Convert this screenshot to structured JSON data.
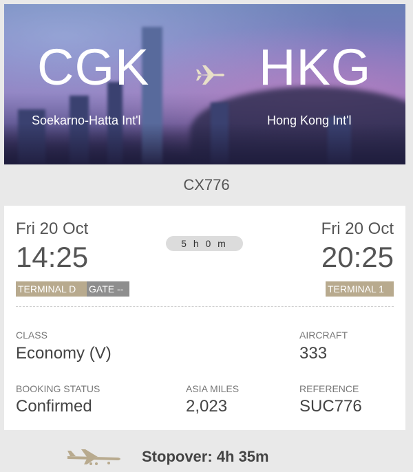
{
  "route": {
    "from_code": "CGK",
    "from_name": "Soekarno-Hatta Int'l",
    "to_code": "HKG",
    "to_name": "Hong Kong Int'l",
    "icon": "airplane-icon"
  },
  "flight_number": "CX776",
  "departure": {
    "date": "Fri 20 Oct",
    "time": "14:25",
    "terminal": "TERMINAL D",
    "gate": "GATE --"
  },
  "arrival": {
    "date": "Fri 20 Oct",
    "time": "20:25",
    "terminal": "TERMINAL 1"
  },
  "duration": "5 h 0 m",
  "details": {
    "class_label": "CLASS",
    "class_value": "Economy (V)",
    "aircraft_label": "AIRCRAFT",
    "aircraft_value": "333",
    "booking_label": "BOOKING STATUS",
    "booking_value": "Confirmed",
    "miles_label": "ASIA MILES",
    "miles_value": "2,023",
    "reference_label": "REFERENCE",
    "reference_value": "SUC776"
  },
  "stopover": {
    "icon": "landing-airplane-icon",
    "text": "Stopover:  4h 35m"
  },
  "colors": {
    "tag_terminal": "#b8aa8e",
    "tag_gate": "#8e8e8e",
    "background": "#e9e9e9"
  }
}
